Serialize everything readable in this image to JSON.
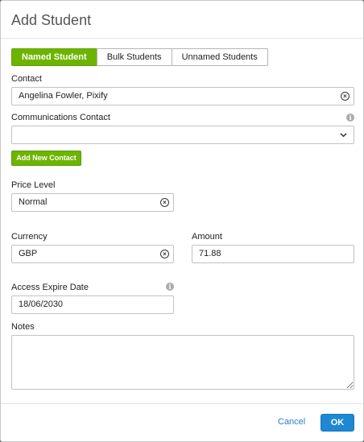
{
  "dialog": {
    "title": "Add Student"
  },
  "tabs": [
    {
      "label": "Named Student",
      "active": true
    },
    {
      "label": "Bulk Students",
      "active": false
    },
    {
      "label": "Unnamed Students",
      "active": false
    }
  ],
  "contact": {
    "label": "Contact",
    "value": "Angelina Fowler, Pixify"
  },
  "communications_contact": {
    "label": "Communications Contact",
    "value": ""
  },
  "add_contact_button": "Add New Contact",
  "price_level": {
    "label": "Price Level",
    "value": "Normal"
  },
  "currency": {
    "label": "Currency",
    "value": "GBP"
  },
  "amount": {
    "label": "Amount",
    "value": "71.88"
  },
  "access_expire": {
    "label": "Access Expire Date",
    "value": "18/06/2030"
  },
  "notes": {
    "label": "Notes",
    "value": ""
  },
  "footer": {
    "cancel_label": "Cancel",
    "ok_label": "OK"
  },
  "colors": {
    "primary_green": "#6db400",
    "ok_blue": "#1e88d2",
    "link_blue": "#2d7ec9"
  },
  "icons": {
    "clear": "clear-circle-icon",
    "info": "info-icon",
    "dropdown": "chevron-down-icon"
  }
}
